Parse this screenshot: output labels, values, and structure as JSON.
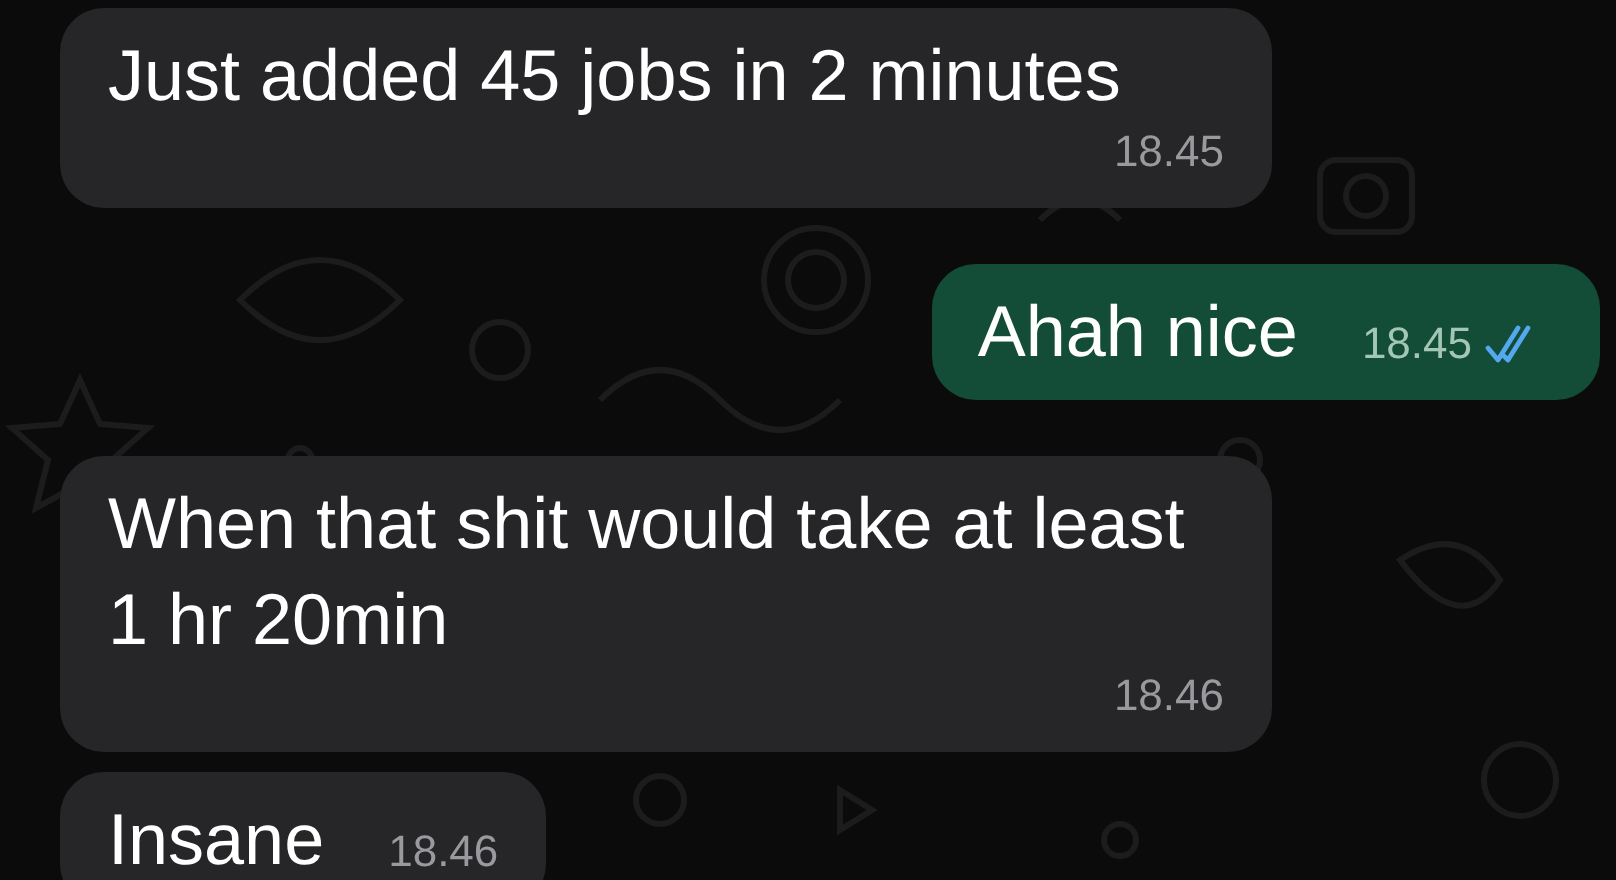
{
  "messages": [
    {
      "outgoing": false,
      "text": "Just added 45 jobs in 2 minutes",
      "time": "18.45"
    },
    {
      "outgoing": true,
      "text": "Ahah nice",
      "time": "18.45",
      "read": true
    },
    {
      "outgoing": false,
      "text": "When that shit would take at least 1 hr 20min",
      "time": "18.46"
    },
    {
      "outgoing": false,
      "text": "Insane",
      "time": "18.46"
    }
  ]
}
